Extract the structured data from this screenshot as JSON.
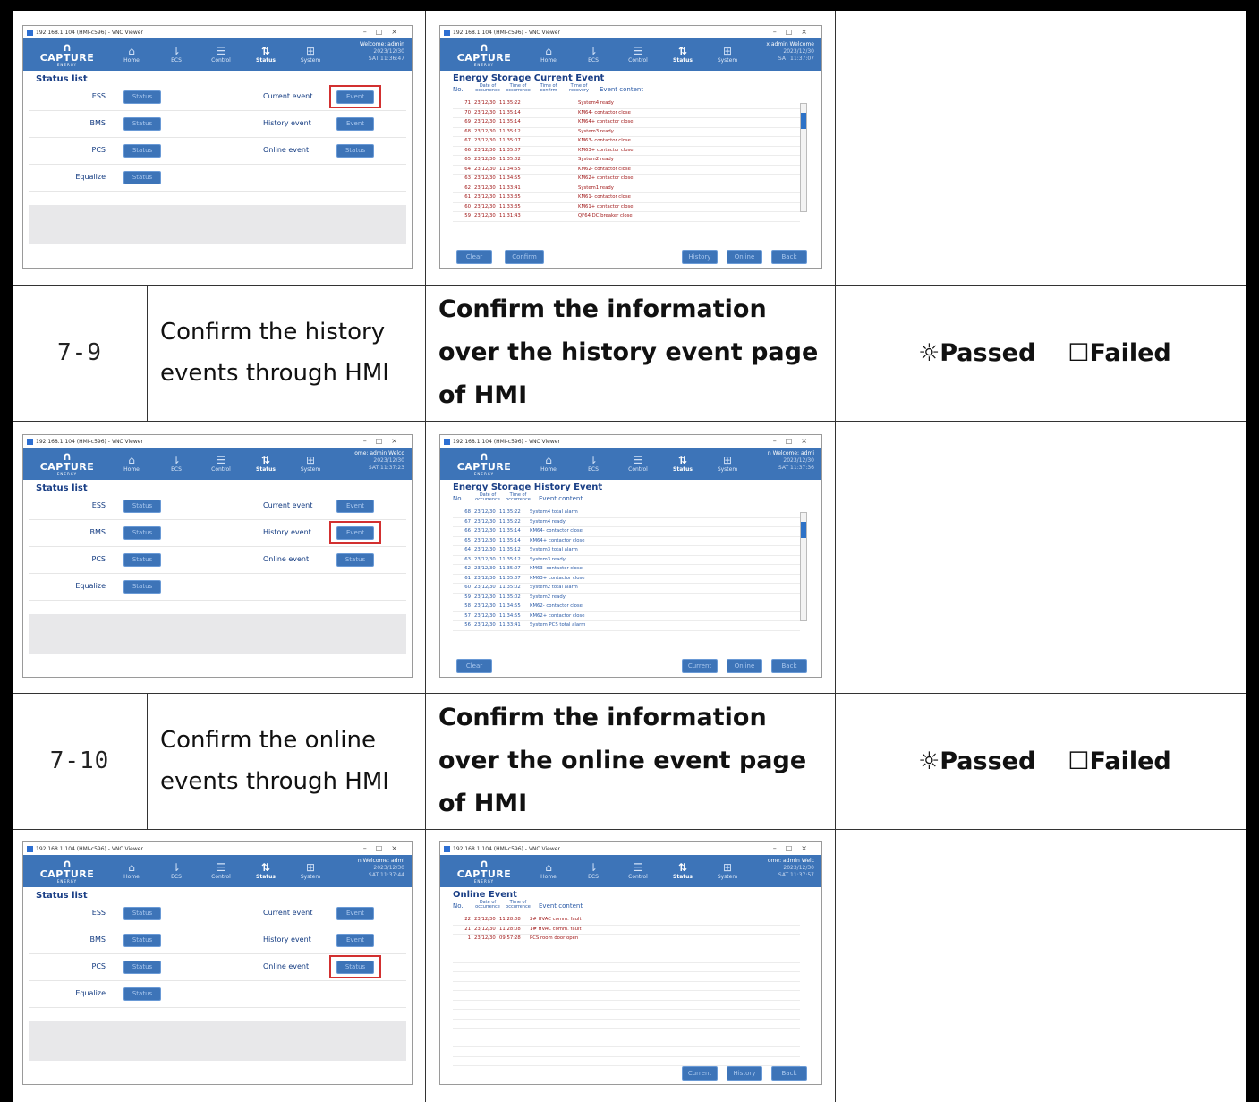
{
  "rows": [
    {
      "num": "7-9",
      "step": "Confirm the history events through HMI",
      "expected": "Confirm the information over the history event page of HMI",
      "passed": "Passed",
      "failed": "Failed"
    },
    {
      "num": "7-10",
      "step": "Confirm the online events through HMI",
      "expected": "Confirm the information over the online event page of HMI",
      "passed": "Passed",
      "failed": "Failed"
    }
  ],
  "result_icons": {
    "passed": "☼",
    "failed": "☐"
  },
  "hmi": {
    "window_title": "192.168.1.104 (HMI-c596) - VNC Viewer",
    "brand": "CAPTURE",
    "brand_sub": "ENERGY",
    "nav": [
      "Home",
      "ECS",
      "Control",
      "Status",
      "System"
    ],
    "welcome": "Welcome: admin",
    "date": "2023/12/30",
    "status_list_title": "Status list",
    "status_rows": [
      {
        "label": "ESS",
        "btn": "Status",
        "right_label": "Current event",
        "right_btn": "Event"
      },
      {
        "label": "BMS",
        "btn": "Status",
        "right_label": "History event",
        "right_btn": "Event"
      },
      {
        "label": "PCS",
        "btn": "Status",
        "right_label": "Online event",
        "right_btn": "Status"
      },
      {
        "label": "Equalize",
        "btn": "Status",
        "right_label": "",
        "right_btn": ""
      }
    ]
  },
  "shots": [
    {
      "left": {
        "time": "SAT 11:36:47",
        "welcome": "Welcome: admin",
        "highlight": "Current event"
      },
      "right": {
        "time": "SAT 11:37:07",
        "welcome": "x admin   Welcome",
        "title": "Energy Storage Current Event",
        "head": {
          "no": "No.",
          "d": "Date of occurrence",
          "t": "Time of occurrence",
          "c": "Time of confirm",
          "r": "Time of recovery",
          "content": "Event content"
        },
        "events": [
          {
            "no": "71",
            "d": "23/12/30",
            "t": "11:35:22",
            "txt": "System4 ready"
          },
          {
            "no": "70",
            "d": "23/12/30",
            "t": "11:35:14",
            "txt": "KM64- contactor close"
          },
          {
            "no": "69",
            "d": "23/12/30",
            "t": "11:35:14",
            "txt": "KM64+ contactor close"
          },
          {
            "no": "68",
            "d": "23/12/30",
            "t": "11:35:12",
            "txt": "System3 ready"
          },
          {
            "no": "67",
            "d": "23/12/30",
            "t": "11:35:07",
            "txt": "KM63- contactor close"
          },
          {
            "no": "66",
            "d": "23/12/30",
            "t": "11:35:07",
            "txt": "KM63+ contactor close"
          },
          {
            "no": "65",
            "d": "23/12/30",
            "t": "11:35:02",
            "txt": "System2 ready"
          },
          {
            "no": "64",
            "d": "23/12/30",
            "t": "11:34:55",
            "txt": "KM62- contactor close"
          },
          {
            "no": "63",
            "d": "23/12/30",
            "t": "11:34:55",
            "txt": "KM62+ contactor close"
          },
          {
            "no": "62",
            "d": "23/12/30",
            "t": "11:33:41",
            "txt": "System1 ready"
          },
          {
            "no": "61",
            "d": "23/12/30",
            "t": "11:33:35",
            "txt": "KM61- contactor close"
          },
          {
            "no": "60",
            "d": "23/12/30",
            "t": "11:33:35",
            "txt": "KM61+ contactor close"
          },
          {
            "no": "59",
            "d": "23/12/30",
            "t": "11:31:43",
            "txt": "QF64 DC breaker close"
          }
        ],
        "buttons": [
          "Clear",
          "Confirm",
          "History",
          "Online",
          "Back"
        ]
      }
    },
    {
      "left": {
        "time": "SAT 11:37:23",
        "welcome": "ome: admin   Welco",
        "highlight": "History event"
      },
      "right": {
        "time": "SAT 11:37:36",
        "welcome": "n   Welcome: admi",
        "title": "Energy Storage History Event",
        "head": {
          "no": "No.",
          "d": "Date of occurrence",
          "t": "Time of occurrence",
          "content": "Event content"
        },
        "events": [
          {
            "no": "68",
            "d": "23/12/30",
            "t": "11:35:22",
            "txt": "System4 total alarm"
          },
          {
            "no": "67",
            "d": "23/12/30",
            "t": "11:35:22",
            "txt": "System4 ready"
          },
          {
            "no": "66",
            "d": "23/12/30",
            "t": "11:35:14",
            "txt": "KM64- contactor close"
          },
          {
            "no": "65",
            "d": "23/12/30",
            "t": "11:35:14",
            "txt": "KM64+ contactor close"
          },
          {
            "no": "64",
            "d": "23/12/30",
            "t": "11:35:12",
            "txt": "System3 total alarm"
          },
          {
            "no": "63",
            "d": "23/12/30",
            "t": "11:35:12",
            "txt": "System3 ready"
          },
          {
            "no": "62",
            "d": "23/12/30",
            "t": "11:35:07",
            "txt": "KM63- contactor close"
          },
          {
            "no": "61",
            "d": "23/12/30",
            "t": "11:35:07",
            "txt": "KM63+ contactor close"
          },
          {
            "no": "60",
            "d": "23/12/30",
            "t": "11:35:02",
            "txt": "System2 total alarm"
          },
          {
            "no": "59",
            "d": "23/12/30",
            "t": "11:35:02",
            "txt": "System2 ready"
          },
          {
            "no": "58",
            "d": "23/12/30",
            "t": "11:34:55",
            "txt": "KM62- contactor close"
          },
          {
            "no": "57",
            "d": "23/12/30",
            "t": "11:34:55",
            "txt": "KM62+ contactor close"
          },
          {
            "no": "56",
            "d": "23/12/30",
            "t": "11:33:41",
            "txt": "System PCS total alarm"
          }
        ],
        "buttons": [
          "Clear",
          "Current",
          "Online",
          "Back"
        ]
      }
    },
    {
      "left": {
        "time": "SAT 11:37:44",
        "welcome": "n   Welcome: admi",
        "highlight": "Online event"
      },
      "right": {
        "time": "SAT 11:37:57",
        "welcome": "ome: admin   Welc",
        "title": "Online Event",
        "head": {
          "no": "No.",
          "d": "Date of occurrence",
          "t": "Time of occurrence",
          "content": "Event content"
        },
        "events": [
          {
            "no": "22",
            "d": "23/12/30",
            "t": "11:28:08",
            "txt": "2# HVAC comm. fault"
          },
          {
            "no": "21",
            "d": "23/12/30",
            "t": "11:28:08",
            "txt": "1# HVAC comm. fault"
          },
          {
            "no": "1",
            "d": "23/12/30",
            "t": "09:57:28",
            "txt": "PCS room door open"
          }
        ],
        "buttons": [
          "Current",
          "History",
          "Back"
        ]
      }
    }
  ]
}
